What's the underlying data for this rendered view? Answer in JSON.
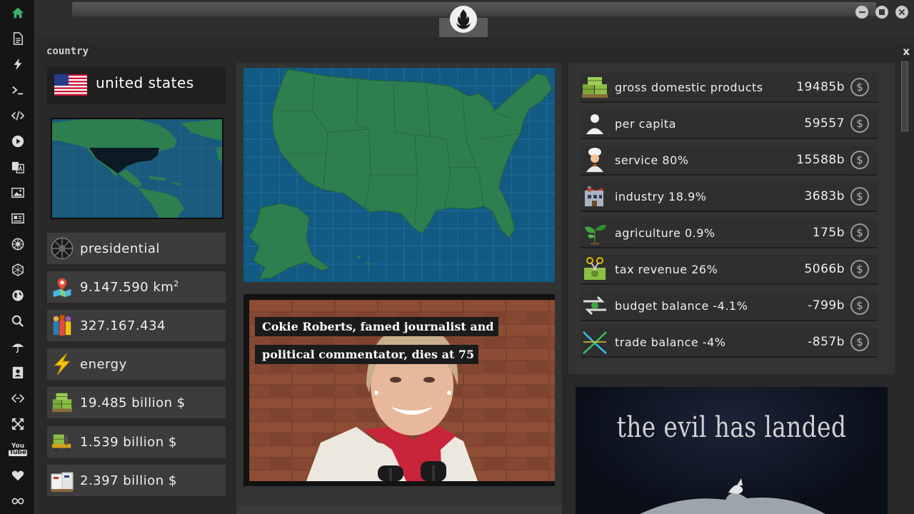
{
  "panel": {
    "title": "country",
    "close": "x"
  },
  "country": {
    "name": "united states",
    "government": "presidential",
    "area_value": "9.147.590 km",
    "area_exp": "2",
    "population": "327.167.434",
    "resource": "energy",
    "gdp": "19.485 billion $",
    "second_money": "1.539 billion $",
    "third_money": "2.397 billion $"
  },
  "news": {
    "headline_line1": "Cokie Roberts, famed journalist and",
    "headline_line2": "political commentator, dies at 75"
  },
  "economy": [
    {
      "label": "gross domestic products",
      "value": "19485b",
      "icon": "money-pallet-icon"
    },
    {
      "label": "per capita",
      "value": "59557",
      "icon": "person-icon"
    },
    {
      "label": "service 80%",
      "value": "15588b",
      "icon": "chef-icon"
    },
    {
      "label": "industry 18.9%",
      "value": "3683b",
      "icon": "factory-icon"
    },
    {
      "label": "agriculture 0.9%",
      "value": "175b",
      "icon": "plant-icon"
    },
    {
      "label": "tax revenue 26%",
      "value": "5066b",
      "icon": "scissors-money-icon"
    },
    {
      "label": "budget balance -4.1%",
      "value": "-799b",
      "icon": "exchange-arrows-icon"
    },
    {
      "label": "trade balance -4%",
      "value": "-857b",
      "icon": "trade-cross-icon"
    }
  ],
  "currency_symbol": "$",
  "poster": {
    "title": "the evil has landed"
  },
  "colors": {
    "map_water": "#115a84",
    "map_land": "#2e7f4f",
    "accent_home": "#3cb371"
  }
}
